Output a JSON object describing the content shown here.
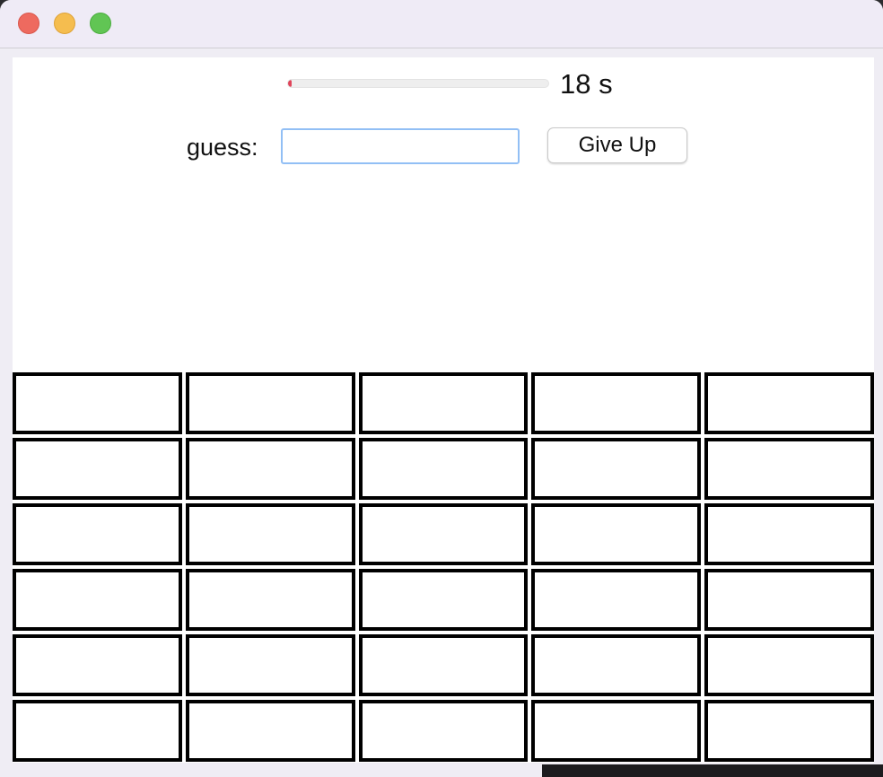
{
  "window": {
    "controls": [
      "close",
      "minimize",
      "zoom"
    ],
    "colors": {
      "close": "#ee6a5f",
      "minimize": "#f5bd4f",
      "zoom": "#61c554"
    }
  },
  "timer": {
    "value": "18 s",
    "progress_fraction": 0.01,
    "progress_color": "#e0455a"
  },
  "guess": {
    "label": "guess:",
    "value": "",
    "placeholder": ""
  },
  "actions": {
    "give_up_label": "Give Up"
  },
  "board": {
    "rows": 6,
    "columns": 5,
    "cells": [
      [
        "",
        "",
        "",
        "",
        ""
      ],
      [
        "",
        "",
        "",
        "",
        ""
      ],
      [
        "",
        "",
        "",
        "",
        ""
      ],
      [
        "",
        "",
        "",
        "",
        ""
      ],
      [
        "",
        "",
        "",
        "",
        ""
      ],
      [
        "",
        "",
        "",
        "",
        ""
      ]
    ]
  }
}
